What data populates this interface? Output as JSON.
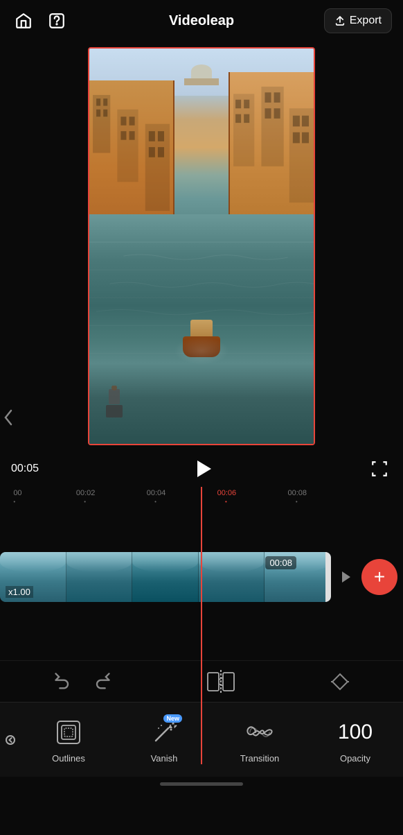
{
  "app": {
    "title": "Videoleap"
  },
  "header": {
    "home_label": "Home",
    "help_label": "Help",
    "export_label": "Export"
  },
  "player": {
    "time": "00:05",
    "play_label": "Play"
  },
  "timeline": {
    "marks": [
      {
        "label": "00",
        "pos": 0
      },
      {
        "label": "00:02",
        "pos": 18
      },
      {
        "label": "00:04",
        "pos": 37
      },
      {
        "label": "00:06",
        "pos": 56
      },
      {
        "label": "00:08",
        "pos": 75
      }
    ],
    "clip_duration": "00:08",
    "clip_speed": "x1.00"
  },
  "toolbar": {
    "undo_label": "Undo",
    "redo_label": "Redo",
    "split_label": "Split"
  },
  "tools": [
    {
      "id": "outlines",
      "label": "Outlines",
      "has_new": false
    },
    {
      "id": "vanish",
      "label": "Vanish",
      "has_new": true
    },
    {
      "id": "transition",
      "label": "Transition",
      "has_new": false
    },
    {
      "id": "opacity",
      "label": "Opacity",
      "value": "100",
      "has_new": false
    }
  ],
  "icons": {
    "home": "⌂",
    "help": "?",
    "export": "↑",
    "play": "▶",
    "fullscreen": "⛶",
    "add": "+",
    "undo": "↩",
    "redo": "↪",
    "diamond": "◇",
    "chevron_left": "‹",
    "chevron_right": "›"
  },
  "colors": {
    "accent": "#e8443a",
    "background": "#0a0a0a",
    "text_primary": "#ffffff",
    "text_secondary": "#888888",
    "badge_blue": "#4a9aff"
  }
}
